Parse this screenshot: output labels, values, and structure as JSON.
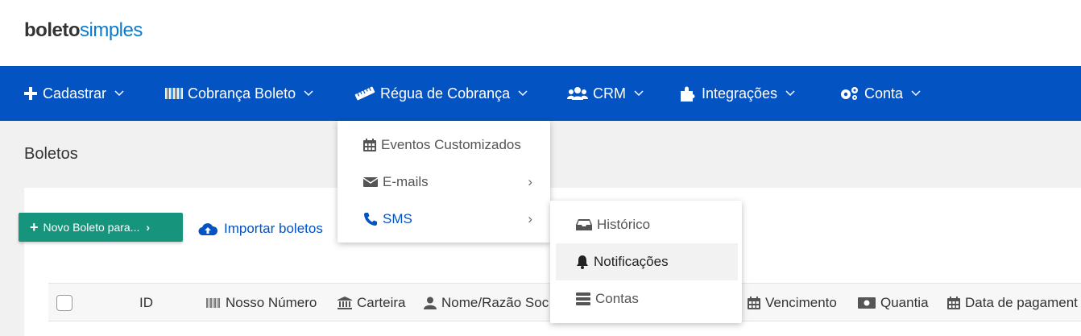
{
  "logo": {
    "part1": "boleto",
    "part2": "simples"
  },
  "nav": {
    "items": [
      {
        "label": "Cadastrar",
        "icon": "plus-icon"
      },
      {
        "label": "Cobrança Boleto",
        "icon": "barcode-icon"
      },
      {
        "label": "Régua de Cobrança",
        "icon": "ruler-icon"
      },
      {
        "label": "CRM",
        "icon": "users-icon"
      },
      {
        "label": "Integrações",
        "icon": "puzzle-icon"
      },
      {
        "label": "Conta",
        "icon": "cogs-icon"
      }
    ]
  },
  "page": {
    "title": "Boletos"
  },
  "actions": {
    "new_boleto": "Novo Boleto para...",
    "import": "Importar boletos"
  },
  "table": {
    "columns": [
      "ID",
      "Nosso Número",
      "Carteira",
      "Nome/Razão Soc",
      "Vencimento",
      "Quantia",
      "Data de pagament"
    ]
  },
  "menu_regua": {
    "items": [
      {
        "label": "Eventos Customizados",
        "icon": "calendar-icon"
      },
      {
        "label": "E-mails",
        "icon": "envelope-icon"
      },
      {
        "label": "SMS",
        "icon": "phone-icon"
      }
    ]
  },
  "menu_sms": {
    "items": [
      {
        "label": "Histórico",
        "icon": "inbox-icon"
      },
      {
        "label": "Notificações",
        "icon": "bell-icon"
      },
      {
        "label": "Contas",
        "icon": "list-icon"
      }
    ]
  },
  "colors": {
    "nav_bg": "#0453c2",
    "accent_green": "#16947c",
    "link_blue": "#0453c2"
  }
}
